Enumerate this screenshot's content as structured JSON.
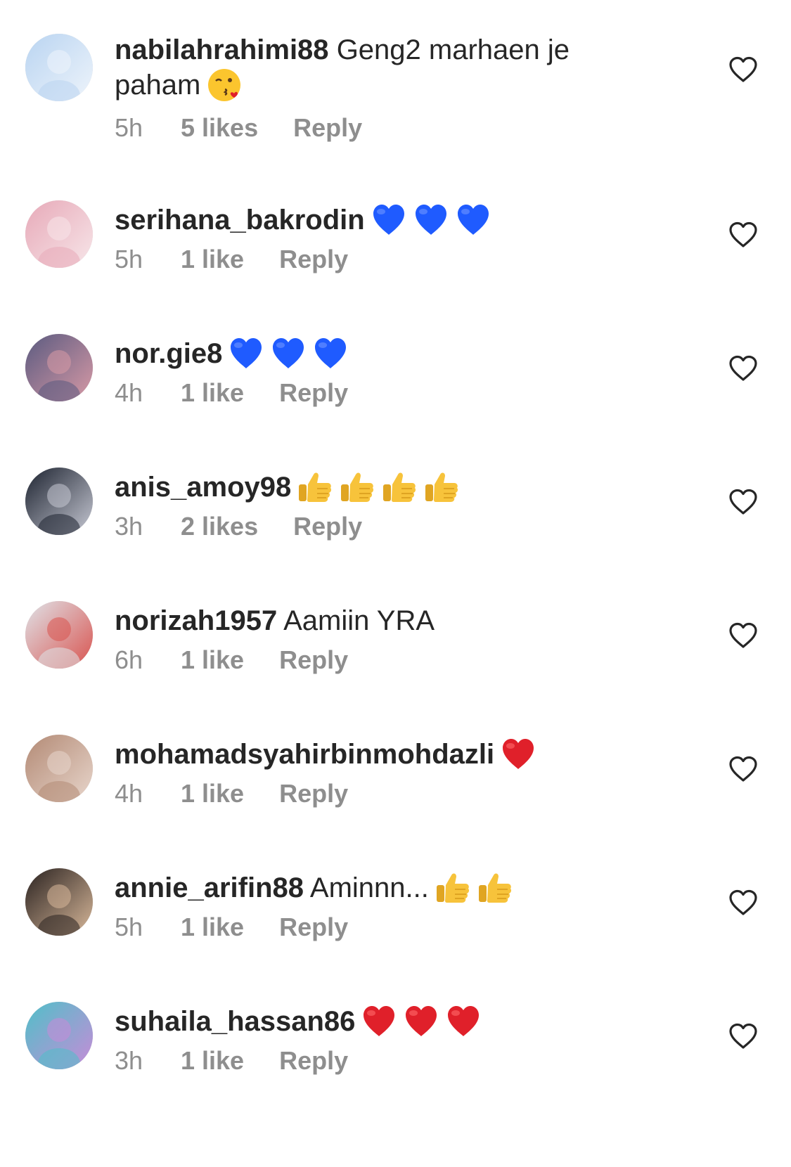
{
  "comments": [
    {
      "username": "nabilahrahimi88",
      "text": "Geng2 marhaen je paham",
      "emojis": [
        "kiss-emoji"
      ],
      "time": "5h",
      "likes": "5 likes",
      "reply": "Reply",
      "avatar_colors": [
        "#b9d4f1",
        "#eef4fb"
      ]
    },
    {
      "username": "serihana_bakrodin",
      "text": "",
      "emojis": [
        "blue-heart-emoji",
        "blue-heart-emoji",
        "blue-heart-emoji"
      ],
      "time": "5h",
      "likes": "1 like",
      "reply": "Reply",
      "avatar_colors": [
        "#e7a9b8",
        "#f7e6e9"
      ]
    },
    {
      "username": "nor.gie8",
      "text": "",
      "emojis": [
        "blue-heart-emoji",
        "blue-heart-emoji",
        "blue-heart-emoji"
      ],
      "time": "4h",
      "likes": "1 like",
      "reply": "Reply",
      "avatar_colors": [
        "#5a5a80",
        "#d89aa6"
      ]
    },
    {
      "username": "anis_amoy98",
      "text": "",
      "emojis": [
        "thumbs-up-emoji",
        "thumbs-up-emoji",
        "thumbs-up-emoji",
        "thumbs-up-emoji"
      ],
      "time": "3h",
      "likes": "2 likes",
      "reply": "Reply",
      "avatar_colors": [
        "#1d2330",
        "#c7c9d4"
      ]
    },
    {
      "username": "norizah1957",
      "text": "Aamiin YRA",
      "emojis": [],
      "time": "6h",
      "likes": "1 like",
      "reply": "Reply",
      "avatar_colors": [
        "#dfe3e8",
        "#d9534f"
      ]
    },
    {
      "username": "mohamadsyahirbinmohdazli",
      "text": "",
      "emojis": [
        "red-heart-emoji"
      ],
      "time": "4h",
      "likes": "1 like",
      "reply": "Reply",
      "avatar_colors": [
        "#b38a75",
        "#e8d6cc"
      ]
    },
    {
      "username": "annie_arifin88",
      "text": "Aminnn...",
      "emojis": [
        "thumbs-up-emoji",
        "thumbs-up-emoji"
      ],
      "time": "5h",
      "likes": "1 like",
      "reply": "Reply",
      "avatar_colors": [
        "#2a2220",
        "#d8b89a"
      ]
    },
    {
      "username": "suhaila_hassan86",
      "text": "",
      "emojis": [
        "red-heart-emoji",
        "red-heart-emoji",
        "red-heart-emoji"
      ],
      "time": "3h",
      "likes": "1 like",
      "reply": "Reply",
      "avatar_colors": [
        "#4fc0c8",
        "#c88bd8"
      ]
    }
  ],
  "colors": {
    "username": "#262626",
    "meta": "#8e8e8e",
    "blue_heart": "#1f5bff",
    "red_heart": "#e0202a",
    "thumbs": "#f7c33b"
  }
}
